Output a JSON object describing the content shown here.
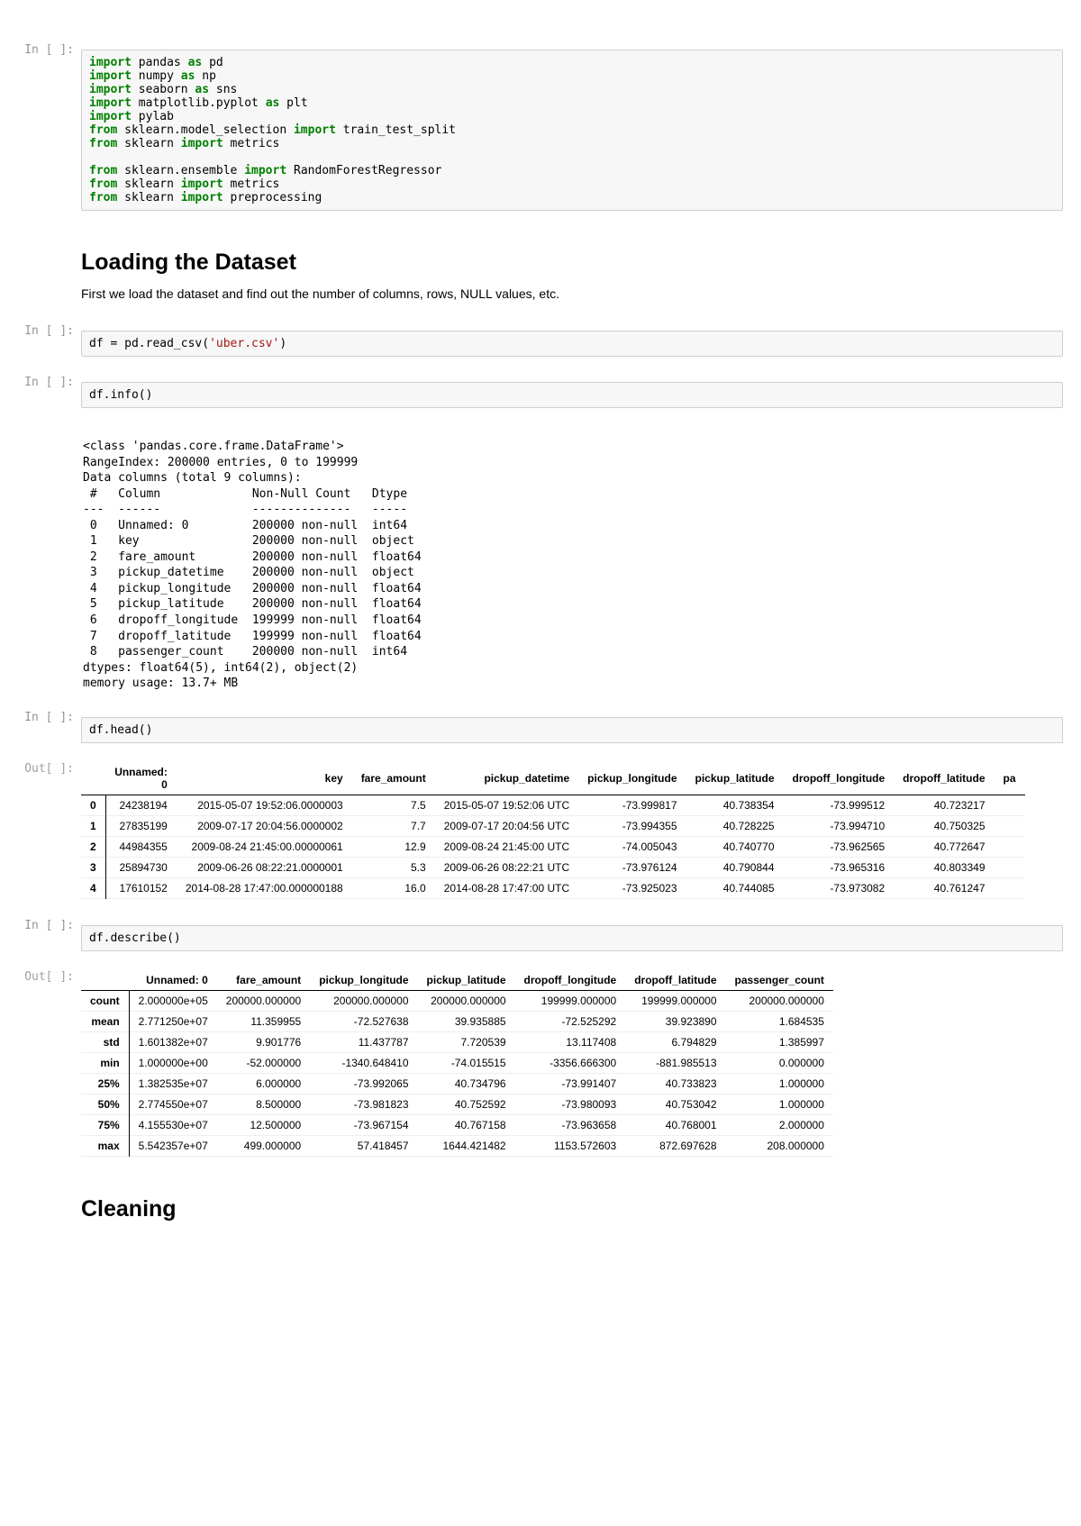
{
  "prompts": {
    "in": "In [ ]:",
    "out": "Out[ ]:"
  },
  "code1": "import pandas as pd\nimport numpy as np\nimport seaborn as sns\nimport matplotlib.pyplot as plt\nimport pylab\nfrom sklearn.model_selection import train_test_split\nfrom sklearn import metrics\n\nfrom sklearn.ensemble import RandomForestRegressor\nfrom sklearn import metrics\nfrom sklearn import preprocessing",
  "md1": {
    "h1": "Loading the Dataset",
    "p": "First we load the dataset and find out the number of columns, rows, NULL values, etc."
  },
  "code2": "df = pd.read_csv('uber.csv')",
  "code3": "df.info()",
  "info_output": "<class 'pandas.core.frame.DataFrame'>\nRangeIndex: 200000 entries, 0 to 199999\nData columns (total 9 columns):\n #   Column             Non-Null Count   Dtype\n---  ------             --------------   -----\n 0   Unnamed: 0         200000 non-null  int64\n 1   key                200000 non-null  object\n 2   fare_amount        200000 non-null  float64\n 3   pickup_datetime    200000 non-null  object\n 4   pickup_longitude   200000 non-null  float64\n 5   pickup_latitude    200000 non-null  float64\n 6   dropoff_longitude  199999 non-null  float64\n 7   dropoff_latitude   199999 non-null  float64\n 8   passenger_count    200000 non-null  int64\ndtypes: float64(5), int64(2), object(2)\nmemory usage: 13.7+ MB",
  "code4": "df.head()",
  "head_table": {
    "columns": [
      "Unnamed: 0",
      "key",
      "fare_amount",
      "pickup_datetime",
      "pickup_longitude",
      "pickup_latitude",
      "dropoff_longitude",
      "dropoff_latitude",
      "pa"
    ],
    "rows": [
      {
        "idx": "0",
        "cells": [
          "24238194",
          "2015-05-07 19:52:06.0000003",
          "7.5",
          "2015-05-07 19:52:06 UTC",
          "-73.999817",
          "40.738354",
          "-73.999512",
          "40.723217",
          ""
        ]
      },
      {
        "idx": "1",
        "cells": [
          "27835199",
          "2009-07-17 20:04:56.0000002",
          "7.7",
          "2009-07-17 20:04:56 UTC",
          "-73.994355",
          "40.728225",
          "-73.994710",
          "40.750325",
          ""
        ]
      },
      {
        "idx": "2",
        "cells": [
          "44984355",
          "2009-08-24 21:45:00.00000061",
          "12.9",
          "2009-08-24 21:45:00 UTC",
          "-74.005043",
          "40.740770",
          "-73.962565",
          "40.772647",
          ""
        ]
      },
      {
        "idx": "3",
        "cells": [
          "25894730",
          "2009-06-26 08:22:21.0000001",
          "5.3",
          "2009-06-26 08:22:21 UTC",
          "-73.976124",
          "40.790844",
          "-73.965316",
          "40.803349",
          ""
        ]
      },
      {
        "idx": "4",
        "cells": [
          "17610152",
          "2014-08-28 17:47:00.000000188",
          "16.0",
          "2014-08-28 17:47:00 UTC",
          "-73.925023",
          "40.744085",
          "-73.973082",
          "40.761247",
          ""
        ]
      }
    ]
  },
  "code5": "df.describe()",
  "describe_table": {
    "columns": [
      "Unnamed: 0",
      "fare_amount",
      "pickup_longitude",
      "pickup_latitude",
      "dropoff_longitude",
      "dropoff_latitude",
      "passenger_count"
    ],
    "rows": [
      {
        "idx": "count",
        "cells": [
          "2.000000e+05",
          "200000.000000",
          "200000.000000",
          "200000.000000",
          "199999.000000",
          "199999.000000",
          "200000.000000"
        ]
      },
      {
        "idx": "mean",
        "cells": [
          "2.771250e+07",
          "11.359955",
          "-72.527638",
          "39.935885",
          "-72.525292",
          "39.923890",
          "1.684535"
        ]
      },
      {
        "idx": "std",
        "cells": [
          "1.601382e+07",
          "9.901776",
          "11.437787",
          "7.720539",
          "13.117408",
          "6.794829",
          "1.385997"
        ]
      },
      {
        "idx": "min",
        "cells": [
          "1.000000e+00",
          "-52.000000",
          "-1340.648410",
          "-74.015515",
          "-3356.666300",
          "-881.985513",
          "0.000000"
        ]
      },
      {
        "idx": "25%",
        "cells": [
          "1.382535e+07",
          "6.000000",
          "-73.992065",
          "40.734796",
          "-73.991407",
          "40.733823",
          "1.000000"
        ]
      },
      {
        "idx": "50%",
        "cells": [
          "2.774550e+07",
          "8.500000",
          "-73.981823",
          "40.752592",
          "-73.980093",
          "40.753042",
          "1.000000"
        ]
      },
      {
        "idx": "75%",
        "cells": [
          "4.155530e+07",
          "12.500000",
          "-73.967154",
          "40.767158",
          "-73.963658",
          "40.768001",
          "2.000000"
        ]
      },
      {
        "idx": "max",
        "cells": [
          "5.542357e+07",
          "499.000000",
          "57.418457",
          "1644.421482",
          "1153.572603",
          "872.697628",
          "208.000000"
        ]
      }
    ]
  },
  "md2": {
    "h1": "Cleaning"
  }
}
